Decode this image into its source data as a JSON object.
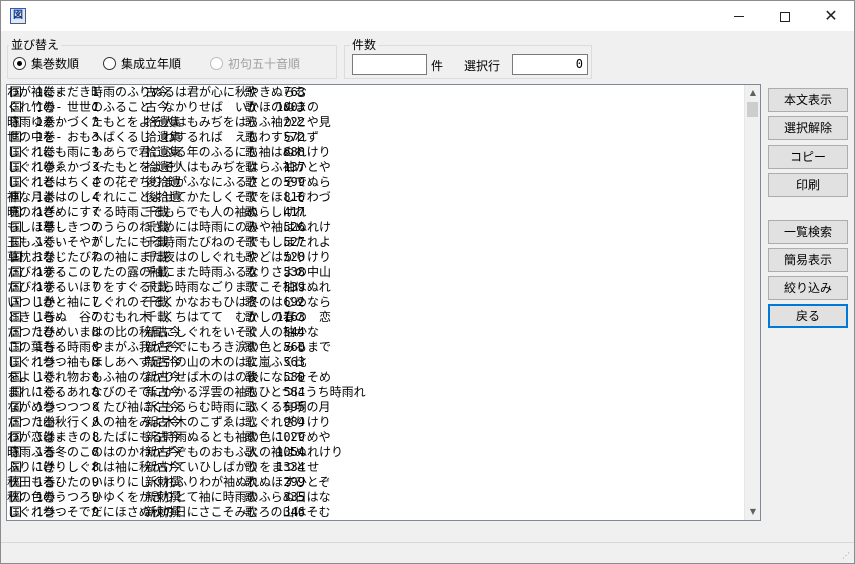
{
  "window": {
    "icon": "app-icon",
    "icon_glyph": "図"
  },
  "sort_group": {
    "label": "並び替え",
    "options": [
      {
        "label": "集巻数順",
        "selected": true,
        "enabled": true
      },
      {
        "label": "集成立年順",
        "selected": false,
        "enabled": true
      },
      {
        "label": "初句五十音順",
        "selected": false,
        "enabled": false
      }
    ]
  },
  "count_group": {
    "label": "件数",
    "count_value": "",
    "count_unit": "件",
    "selected_row_label": "選択行",
    "selected_row_value": "0"
  },
  "list": {
    "rows": [
      {
        "kan": "国",
        "maki": "1巻-",
        "no": "1",
        "shu": "古今",
        "kind": "歌",
        "num": "763",
        "text": "わが袖にまだき時雨のふりぬるは君が心に秋やきぬらむ"
      },
      {
        "kan": "国",
        "maki": "1巻-",
        "no": "1",
        "shu": "古今",
        "kind": "歌",
        "num": "1003",
        "text": "くれ竹の　世世のふること　なかりせば　いかほのぬまの"
      },
      {
        "kan": "国",
        "maki": "1巻-",
        "no": "3",
        "shu": "拾遺集",
        "kind": "歌",
        "num": "222",
        "text": "時雨ゆゑかづくたもとをよそ人はもみぢをはらふ袖かとや見"
      },
      {
        "kan": "国",
        "maki": "1巻-",
        "no": "3",
        "shu": "拾遺集",
        "kind": "歌",
        "num": "572",
        "text": "世の中を　おもへばくるし　わするれば　えもわすられず"
      },
      {
        "kan": "国",
        "maki": "1巻-",
        "no": "3",
        "shu": "拾遺集",
        "kind": "歌",
        "num": "688",
        "text": "しぐれにも雨にもあらで君こふる年のふるにも袖はぬれけり"
      },
      {
        "kan": "国",
        "maki": "1巻-",
        "no": "3~",
        "shu": "拾遺抄",
        "kind": "歌",
        "num": "137",
        "text": "しぐれゆゑかづくたもとをよそ人はもみぢをはらふ袖かとや"
      },
      {
        "kan": "国",
        "maki": "1巻-",
        "no": "4",
        "shu": "後拾遺",
        "kind": "歌",
        "num": "599",
        "text": "しぐれとはちくさの花ぞちりまがふなにふるさとのそでぬら"
      },
      {
        "kan": "国",
        "maki": "1巻-",
        "no": "4",
        "shu": "後拾遺",
        "kind": "歌",
        "num": "816",
        "text": "神な月よはのしぐれにことよせてかたしくそでをほしぞわづ"
      },
      {
        "kan": "国",
        "maki": "1巻-",
        "no": "7",
        "shu": "千載",
        "kind": "歌",
        "num": "417",
        "text": "暁のねざめにすぐる時雨こそもらでも人の袖ぬらしけれ"
      },
      {
        "kan": "国",
        "maki": "1巻-",
        "no": "7",
        "shu": "千載",
        "kind": "歌",
        "num": "526",
        "text": "もしほ草しきつのうらのねざめには時雨にのみや袖はぬれけ"
      },
      {
        "kan": "国",
        "maki": "1巻-",
        "no": "7",
        "shu": "千載",
        "kind": "歌",
        "num": "527",
        "text": "玉もふくいそやがしたにもる時雨たびねのそでもしほたれよ"
      },
      {
        "kan": "国",
        "maki": "1巻-",
        "no": "7",
        "shu": "千載",
        "kind": "歌",
        "num": "528",
        "text": "草枕おなじたびねの袖にまた夜はのしぐれもやどはかりけり"
      },
      {
        "kan": "国",
        "maki": "1巻-",
        "no": "7",
        "shu": "千載",
        "kind": "歌",
        "num": "538",
        "text": "たびねするこのしたの露の袖にまた時雨ふるなりさよの中山"
      },
      {
        "kan": "国",
        "maki": "1巻-",
        "no": "7",
        "shu": "千載",
        "kind": "歌",
        "num": "539",
        "text": "たびねするいほりをすぐるむら時雨なごりまでこそ袖はぬれ"
      },
      {
        "kan": "国",
        "maki": "1巻-",
        "no": "7",
        "shu": "千載",
        "kind": "歌",
        "num": "692",
        "text": "いつしかと袖にしぐれのそそくかなおもひは冬のはじめなら"
      },
      {
        "kan": "国",
        "maki": "1巻-",
        "no": "7",
        "shu": "千載",
        "kind": "歌",
        "num": "1163",
        "text": "ときしらぬ　谷のむもれ木　くちはてて　むかしの春の　恋"
      },
      {
        "kan": "国",
        "maki": "1巻-",
        "no": "8",
        "shu": "新古今",
        "kind": "歌",
        "num": "544",
        "text": "たつたひめいまはの比の秋風にしぐれをいそぐ人の袖かな"
      },
      {
        "kan": "国",
        "maki": "1巻-",
        "no": "8",
        "shu": "新古今",
        "kind": "歌",
        "num": "560",
        "text": "この葉ちる時雨やまがふ我がそでにもろき涙の色とみるまで"
      },
      {
        "kan": "国",
        "maki": "1巻-",
        "no": "8",
        "shu": "新古今",
        "kind": "歌",
        "num": "563",
        "text": "しぐれつつ袖もほしあへず足引の山の木のはに嵐ふく比"
      },
      {
        "kan": "国",
        "maki": "1巻-",
        "no": "8",
        "shu": "新古今",
        "kind": "歌",
        "num": "580",
        "text": "をよしぐれ物おもふ袖のなかりせば木のはの後になにをそめ"
      },
      {
        "kan": "国",
        "maki": "1巻-",
        "no": "8",
        "shu": "新古今",
        "kind": "歌",
        "num": "584",
        "text": "まれにくるあれなびのそでにかかる浮雲の袖もひとつにうち時雨れ"
      },
      {
        "kan": "国",
        "maki": "1巻-",
        "no": "8",
        "shu": "新古今",
        "kind": "歌",
        "num": "595",
        "text": "ながめつつつつくたび袖にくもるらむ時雨にふくる有明の月"
      },
      {
        "kan": "国",
        "maki": "1巻-",
        "no": "8",
        "shu": "新古今",
        "kind": "歌",
        "num": "984",
        "text": "たつた山秋行く人の袖をみよ木木のこずゑはしぐれざりけり"
      },
      {
        "kan": "国",
        "maki": "1巻-",
        "no": "8",
        "shu": "新古今",
        "kind": "歌",
        "num": "1029",
        "text": "わが恋はまきのしたばにもる時雨ぬるとも袖の色にいでめや"
      },
      {
        "kan": "国",
        "maki": "1巻-",
        "no": "8",
        "shu": "新古今",
        "kind": "歌",
        "num": "1054",
        "text": "時雨ふる冬のこのはのかわかずぞものおもふ人の袖はぬれけり"
      },
      {
        "kan": "国",
        "maki": "1巻-",
        "no": "8",
        "shu": "新古今",
        "kind": "歌",
        "num": "1334",
        "text": "ふりにけりしぐれは袖に秋かけていひしばかりをまつとせ"
      },
      {
        "kan": "国",
        "maki": "1巻-",
        "no": "9",
        "shu": "新勅撰",
        "kind": "歌",
        "num": "299",
        "text": "秋田もるひたのいほりにしぐれふりわが袖ぬれぬほすひとぞ"
      },
      {
        "kan": "国",
        "maki": "1巻-",
        "no": "9",
        "shu": "新勅撰",
        "kind": "歌",
        "num": "335",
        "text": "秋の色のうつろひゆくをかぎりとて袖に時雨のふらぬ日はな"
      },
      {
        "kan": "国",
        "maki": "1巻-",
        "no": "9",
        "shu": "新勅撰",
        "kind": "歌",
        "num": "346",
        "text": "しぐれつつそでだにほさぬ秋の日にさこそみむろの山はそむ"
      }
    ]
  },
  "buttons": {
    "honbun": "本文表示",
    "unselect": "選択解除",
    "copy": "コピー",
    "print": "印刷",
    "search_list": "一覧検索",
    "simple_view": "簡易表示",
    "filter": "絞り込み",
    "back": "戻る"
  }
}
